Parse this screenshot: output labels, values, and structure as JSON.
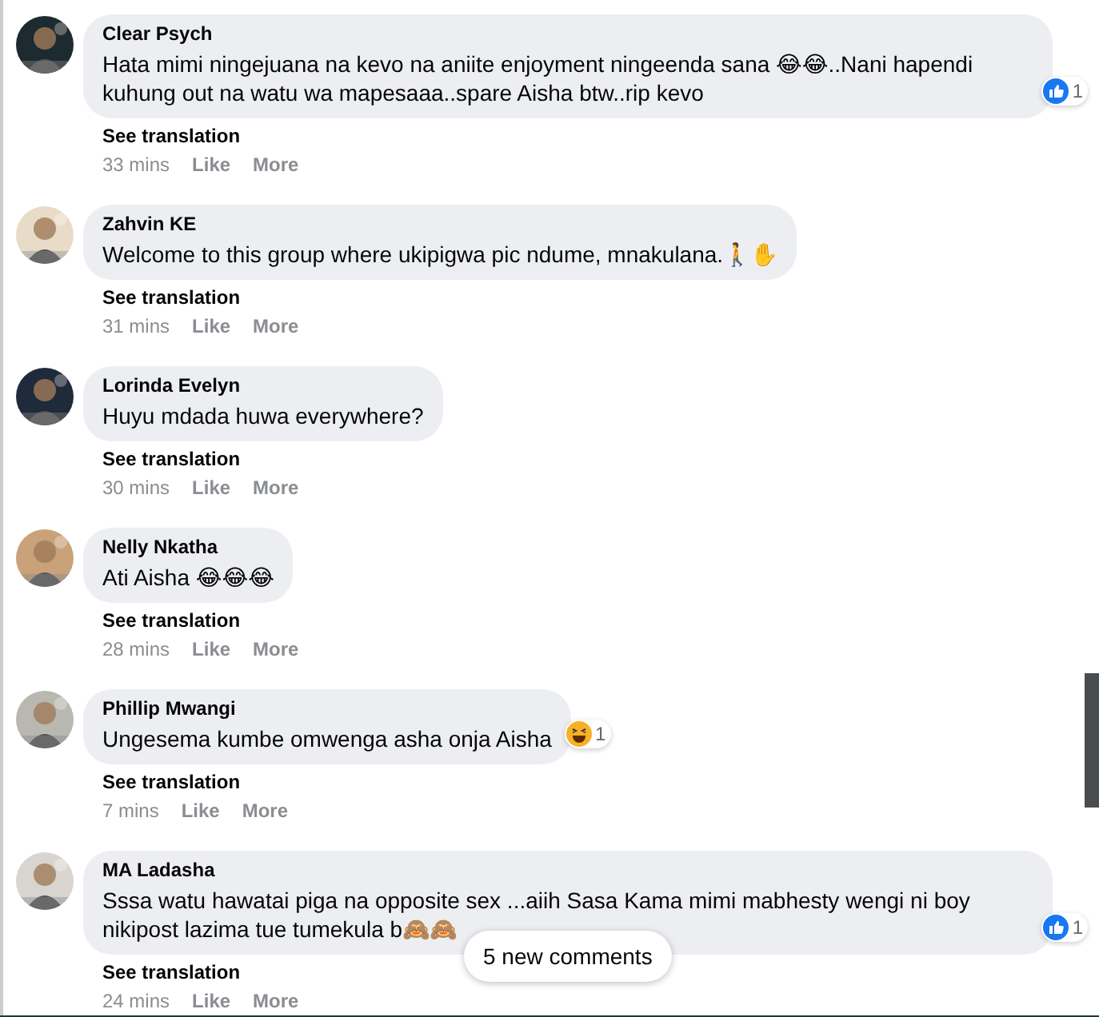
{
  "comments": [
    {
      "author": "Clear Psych",
      "text": "Hata mimi ningejuana na kevo na aniite enjoyment ningeenda sana 😂😂..Nani hapendi kuhung out na watu wa mapesaaa..spare Aisha btw..rip kevo",
      "reaction": {
        "kind": "like",
        "count": "1"
      },
      "translate": "See translation",
      "time": "33 mins",
      "like": "Like",
      "more": "More"
    },
    {
      "author": "Zahvin KE",
      "text": "Welcome to this group where ukipigwa pic ndume, mnakulana.🚶✋",
      "translate": "See translation",
      "time": "31 mins",
      "like": "Like",
      "more": "More"
    },
    {
      "author": "Lorinda Evelyn",
      "text": "Huyu mdada huwa everywhere?",
      "translate": "See translation",
      "time": "30 mins",
      "like": "Like",
      "more": "More"
    },
    {
      "author": "Nelly Nkatha",
      "text": "Ati Aisha 😂😂😂",
      "translate": "See translation",
      "time": "28 mins",
      "like": "Like",
      "more": "More"
    },
    {
      "author": "Phillip Mwangi",
      "text": "Ungesema kumbe omwenga asha onja Aisha",
      "reaction": {
        "kind": "haha",
        "count": "1"
      },
      "translate": "See translation",
      "time": "7 mins",
      "like": "Like",
      "more": "More"
    },
    {
      "author": "MA Ladasha",
      "text": "Sssa watu hawatai piga na opposite sex ...aiih Sasa Kama mimi mabhesty wengi ni boy nikipost lazima tue tumekula b🙈🙈",
      "reaction": {
        "kind": "like",
        "count": "1"
      },
      "translate": "See translation",
      "time": "24 mins",
      "like": "Like",
      "more": "More"
    }
  ],
  "new_comments": "5 new comments"
}
